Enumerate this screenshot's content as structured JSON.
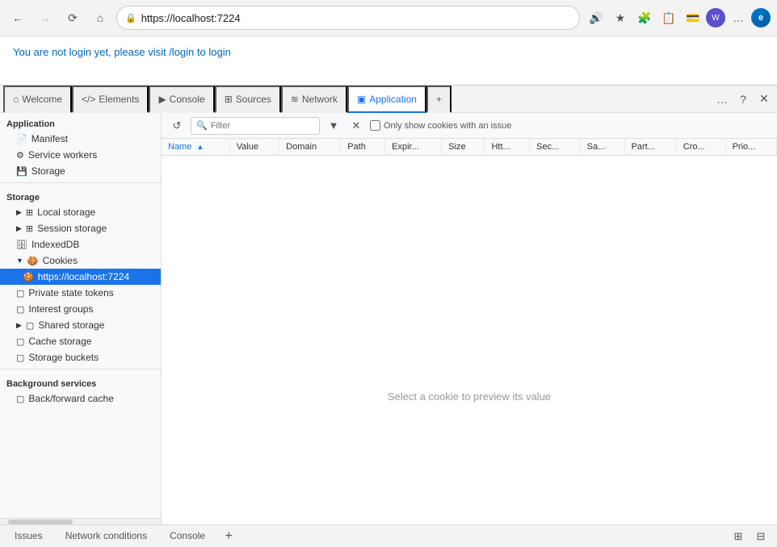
{
  "browser": {
    "url": "https://localhost:7224",
    "back_disabled": false,
    "forward_disabled": true
  },
  "page": {
    "message": "You are not login yet, please visit /login to login"
  },
  "devtools": {
    "tabs": [
      {
        "id": "welcome",
        "label": "Welcome",
        "icon": "⌂",
        "active": false
      },
      {
        "id": "elements",
        "label": "Elements",
        "icon": "</>",
        "active": false
      },
      {
        "id": "console",
        "label": "Console",
        "icon": "▶",
        "active": false
      },
      {
        "id": "sources",
        "label": "Sources",
        "icon": "⊞",
        "active": false
      },
      {
        "id": "network",
        "label": "Network",
        "icon": "≋",
        "active": false
      },
      {
        "id": "application",
        "label": "Application",
        "icon": "▣",
        "active": true
      }
    ],
    "sidebar": {
      "section_application": "Application",
      "items_application": [
        {
          "id": "manifest",
          "label": "Manifest",
          "icon": "📄",
          "indent": 1,
          "expand": false
        },
        {
          "id": "service-workers",
          "label": "Service workers",
          "icon": "⚙",
          "indent": 1,
          "expand": false
        },
        {
          "id": "storage",
          "label": "Storage",
          "icon": "💾",
          "indent": 1,
          "expand": false
        }
      ],
      "section_storage": "Storage",
      "items_storage": [
        {
          "id": "local-storage",
          "label": "Local storage",
          "icon": "⊞",
          "indent": 1,
          "expand": true,
          "has_arrow": true
        },
        {
          "id": "session-storage",
          "label": "Session storage",
          "icon": "⊞",
          "indent": 1,
          "expand": true,
          "has_arrow": true
        },
        {
          "id": "indexeddb",
          "label": "IndexedDB",
          "icon": "🗄",
          "indent": 1,
          "expand": false
        },
        {
          "id": "cookies",
          "label": "Cookies",
          "icon": "🍪",
          "indent": 1,
          "expand": true,
          "has_arrow": true,
          "expanded": true
        },
        {
          "id": "cookies-localhost",
          "label": "https://localhost:7224",
          "icon": "🍪",
          "indent": 2,
          "expand": false,
          "active": true
        },
        {
          "id": "private-state-tokens",
          "label": "Private state tokens",
          "icon": "▢",
          "indent": 1,
          "expand": false
        },
        {
          "id": "interest-groups",
          "label": "Interest groups",
          "icon": "▢",
          "indent": 1,
          "expand": false
        },
        {
          "id": "shared-storage",
          "label": "Shared storage",
          "icon": "▢",
          "indent": 1,
          "expand": true,
          "has_arrow": true
        },
        {
          "id": "cache-storage",
          "label": "Cache storage",
          "icon": "▢",
          "indent": 1,
          "expand": false
        },
        {
          "id": "storage-buckets",
          "label": "Storage buckets",
          "icon": "▢",
          "indent": 1,
          "expand": false
        }
      ],
      "section_background": "Background services",
      "items_background": [
        {
          "id": "back-forward-cache",
          "label": "Back/forward cache",
          "icon": "▢",
          "indent": 1,
          "expand": false
        }
      ]
    },
    "toolbar": {
      "refresh_label": "↺",
      "filter_label": "🔍",
      "filter_placeholder": "Filter",
      "clear_label": "▼",
      "delete_label": "✕",
      "checkbox_label": "Only show cookies with an issue"
    },
    "table": {
      "columns": [
        {
          "id": "name",
          "label": "Name",
          "sorted": true
        },
        {
          "id": "value",
          "label": "Value"
        },
        {
          "id": "domain",
          "label": "Domain"
        },
        {
          "id": "path",
          "label": "Path"
        },
        {
          "id": "expires",
          "label": "Expir..."
        },
        {
          "id": "size",
          "label": "Size"
        },
        {
          "id": "http",
          "label": "Htt..."
        },
        {
          "id": "secure",
          "label": "Sec..."
        },
        {
          "id": "samesite",
          "label": "Sa..."
        },
        {
          "id": "partition",
          "label": "Part..."
        },
        {
          "id": "cross",
          "label": "Cro..."
        },
        {
          "id": "priority",
          "label": "Prio..."
        }
      ],
      "rows": [],
      "empty_message": "Select a cookie to preview its value"
    },
    "bottom_tabs": [
      {
        "id": "issues",
        "label": "Issues",
        "active": false
      },
      {
        "id": "network-conditions",
        "label": "Network conditions",
        "active": false
      },
      {
        "id": "console",
        "label": "Console",
        "active": false
      }
    ]
  }
}
